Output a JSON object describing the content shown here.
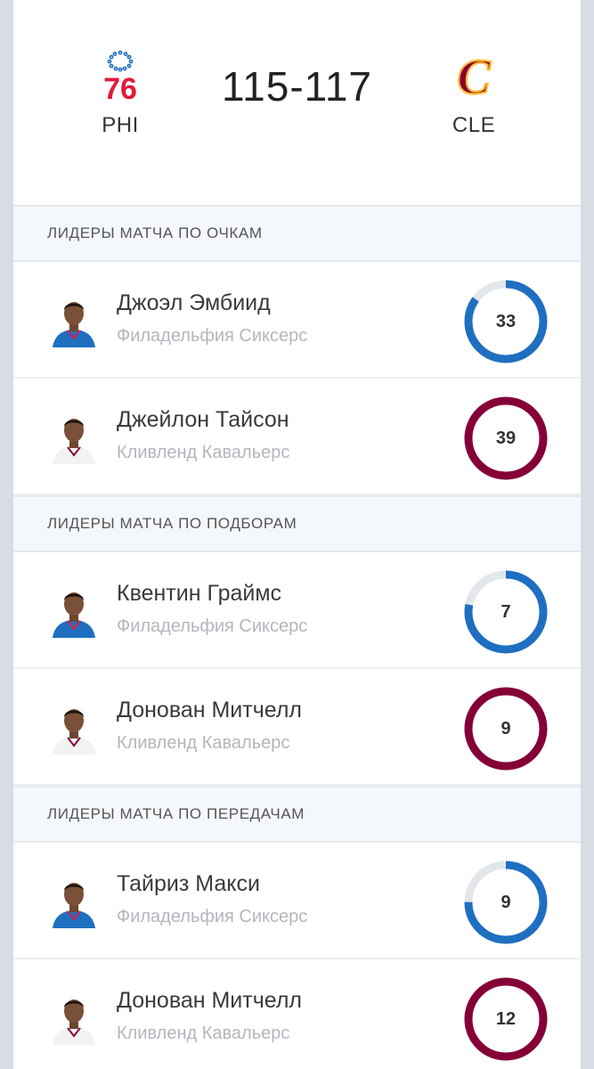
{
  "colors": {
    "phi": "#1f6fc1",
    "cle": "#860038",
    "track": "#e3e6ea"
  },
  "game": {
    "home_abbr": "PHI",
    "away_abbr": "CLE",
    "score": "115-117",
    "home_logo_text": "76",
    "away_logo_text": "C"
  },
  "sections": [
    {
      "title": "ЛИДЕРЫ МАТЧА ПО ОЧКАМ",
      "rows": [
        {
          "name": "Джоэл Эмбиид",
          "team": "Филадельфия Сиксерс",
          "value": "33",
          "club": "phi",
          "fill": 0.85
        },
        {
          "name": "Джейлон Тайсон",
          "team": "Кливленд Кавальерс",
          "value": "39",
          "club": "cle",
          "fill": 1.0
        }
      ]
    },
    {
      "title": "ЛИДЕРЫ МАТЧА ПО ПОДБОРАМ",
      "rows": [
        {
          "name": "Квентин Граймс",
          "team": "Филадельфия Сиксерс",
          "value": "7",
          "club": "phi",
          "fill": 0.78
        },
        {
          "name": "Донован Митчелл",
          "team": "Кливленд Кавальерс",
          "value": "9",
          "club": "cle",
          "fill": 1.0
        }
      ]
    },
    {
      "title": "ЛИДЕРЫ МАТЧА ПО ПЕРЕДАЧАМ",
      "rows": [
        {
          "name": "Тайриз Макси",
          "team": "Филадельфия Сиксерс",
          "value": "9",
          "club": "phi",
          "fill": 0.75
        },
        {
          "name": "Донован Митчелл",
          "team": "Кливленд Кавальерс",
          "value": "12",
          "club": "cle",
          "fill": 1.0
        }
      ]
    }
  ]
}
